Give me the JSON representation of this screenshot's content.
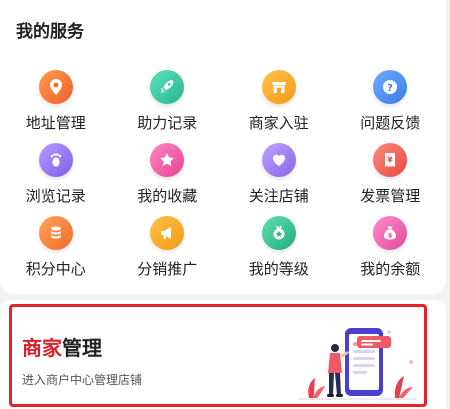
{
  "services": {
    "title": "我的服务",
    "items": [
      {
        "label": "地址管理",
        "icon": "location-pin-icon",
        "color": "#f7793c"
      },
      {
        "label": "助力记录",
        "icon": "rocket-icon",
        "color": "#3bc7a3"
      },
      {
        "label": "商家入驻",
        "icon": "storefront-icon",
        "color": "#f6a623"
      },
      {
        "label": "问题反馈",
        "icon": "question-icon",
        "color": "#4a8ff5"
      },
      {
        "label": "浏览记录",
        "icon": "footprint-icon",
        "color": "#9b7cf2"
      },
      {
        "label": "我的收藏",
        "icon": "star-icon",
        "color": "#ef5fa8"
      },
      {
        "label": "关注店铺",
        "icon": "heart-icon",
        "color": "#a07cf0"
      },
      {
        "label": "发票管理",
        "icon": "invoice-yen-icon",
        "color": "#f2615a"
      },
      {
        "label": "积分中心",
        "icon": "coins-stack-icon",
        "color": "#f7843a"
      },
      {
        "label": "分销推广",
        "icon": "megaphone-icon",
        "color": "#f6a423"
      },
      {
        "label": "我的等级",
        "icon": "medal-icon",
        "color": "#37c28e"
      },
      {
        "label": "我的余额",
        "icon": "money-bag-icon",
        "color": "#ee62b0"
      }
    ]
  },
  "merchant": {
    "title_highlight": "商家",
    "title_rest": "管理",
    "subtitle": "进入商户中心管理店铺",
    "highlight_color": "#d9232d",
    "outline_color": "#e8222a"
  }
}
